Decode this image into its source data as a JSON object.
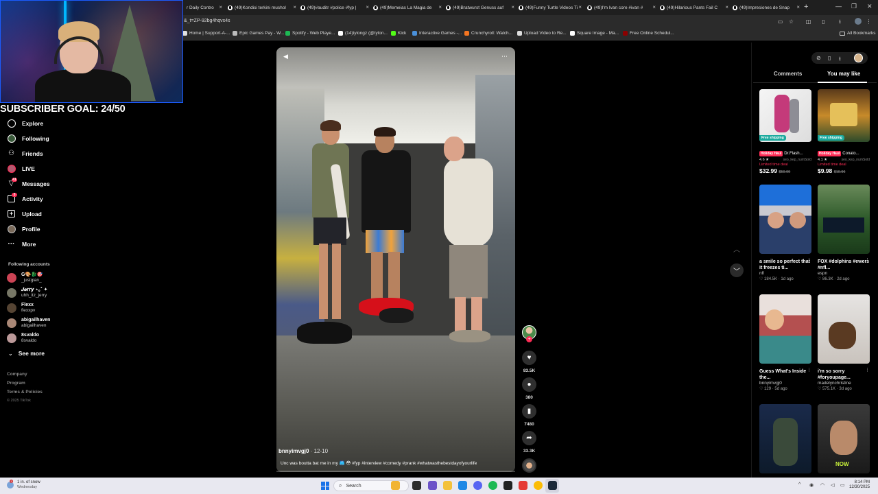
{
  "browser": {
    "tabs": [
      {
        "label": "r Daily Contro",
        "icon": "web-icon"
      },
      {
        "label": "(49)Kondisi terkini mushol",
        "icon": "tiktok-icon"
      },
      {
        "label": "(49)#auditr #police #fyp |",
        "icon": "tiktok-icon"
      },
      {
        "label": "(49)Memeias La Magia de",
        "icon": "tiktok-icon"
      },
      {
        "label": "(49)Bratwurst Genuss auf",
        "icon": "tiktok-icon"
      },
      {
        "label": "(49)Funny Turtle Videos Ti",
        "icon": "tiktok-icon"
      },
      {
        "label": "(49)I'm Ivan core #ivan #",
        "icon": "tiktok-icon"
      },
      {
        "label": "(49)Hilarious Pants Fail C",
        "icon": "tiktok-icon"
      },
      {
        "label": "(49)Impresiones de Snap",
        "icon": "tiktok-icon"
      }
    ],
    "tab_close_glyph": "×",
    "new_tab_glyph": "+",
    "url": "&_t=ZP-92bg4hqvs4s",
    "bookmarks": [
      {
        "label": "Home | Support-A-...",
        "color": "#e0e0e0"
      },
      {
        "label": "Epic Games Pay - W...",
        "color": "#bbbbbb"
      },
      {
        "label": "Spotify - Web Playe...",
        "color": "#1db954"
      },
      {
        "label": "(14)tylongz (@tylon...",
        "color": "#ffffff"
      },
      {
        "label": "Kick",
        "color": "#53fc18"
      },
      {
        "label": "Interactive Games -...",
        "color": "#4a90d9"
      },
      {
        "label": "Crunchyroll: Watch...",
        "color": "#f47521"
      },
      {
        "label": "Upload Video to Re...",
        "color": "#dddddd"
      },
      {
        "label": "Square Image - Ma...",
        "color": "#ffffff"
      },
      {
        "label": "Free Online Schedul...",
        "color": "#8b0000"
      }
    ],
    "all_bookmarks": "All Bookmarks"
  },
  "overlay": {
    "subscriber_goal": "SUBSCRIBER GOAL: 24/50"
  },
  "sidebar": {
    "items": [
      {
        "label": "Explore",
        "icon": "compass-icon"
      },
      {
        "label": "Following",
        "icon": "following-icon"
      },
      {
        "label": "Friends",
        "icon": "friends-icon"
      },
      {
        "label": "LIVE",
        "icon": "live-icon"
      },
      {
        "label": "Messages",
        "icon": "messages-icon",
        "badge": "41"
      },
      {
        "label": "Activity",
        "icon": "activity-icon",
        "badge": "3"
      },
      {
        "label": "Upload",
        "icon": "upload-icon"
      },
      {
        "label": "Profile",
        "icon": "profile-icon"
      },
      {
        "label": "More",
        "icon": "more-icon"
      }
    ],
    "following_title": "Following accounts",
    "following": [
      {
        "name": "G🎨🐉🎯",
        "handle": "_justgian_",
        "color": "#c45"
      },
      {
        "name": "𝑱𝒆𝒓𝒓𝒚 ⋆｡˚ ✦",
        "handle": "uhh_itz_jerry",
        "color": "#776"
      },
      {
        "name": "Flexx",
        "handle": "flexxpv",
        "color": "#543"
      },
      {
        "name": "abigailhaven",
        "handle": "abigailhaven",
        "color": "#a87"
      },
      {
        "name": "8svaldo",
        "handle": "8svaldo",
        "color": "#b99"
      }
    ],
    "see_more": "See more",
    "footer": [
      "Company",
      "Program",
      "Terms & Policies"
    ],
    "copyright": "© 2025 TikTok"
  },
  "video": {
    "author": "bnnyimvgj0",
    "date": "· 12-10",
    "caption": "Unc was boutta bat me in my 🩳 😳 #fyp #interview #comedy #prank #whatwasthebestdayofyourlife",
    "progress": 0.0,
    "likes": "83.5K",
    "comments": "380",
    "saves": "7480",
    "shares": "33.3K"
  },
  "right_panel": {
    "tabs": [
      "Comments",
      "You may like"
    ],
    "active_tab": "You may like",
    "products": [
      {
        "shipping": "Free shipping",
        "holiday": "Holiday Haul",
        "name": "Dr.Flash...",
        "rating": "4.6 ★",
        "sold": "seo_kep_numSold",
        "deal": "Limited time deal",
        "price": "$32.99",
        "old_price": "$59.99"
      },
      {
        "shipping": "Free shipping",
        "holiday": "Holiday Haul",
        "name": "Conato...",
        "rating": "4.1 ★",
        "sold": "seo_kep_numSold",
        "deal": "Limited time deal",
        "price": "$9.98",
        "old_price": "$19.96"
      }
    ],
    "videos": [
      {
        "title": "a smile so perfect that it freezes ti...",
        "author": "nfl",
        "likes": "184.5K",
        "age": "1d ago"
      },
      {
        "title": "FOX #dolphins #ewers #nfl...",
        "author": "espn",
        "likes": "86.3K",
        "age": "2d ago"
      },
      {
        "title": "Guess What's Inside the...",
        "author": "bnnyimvgj0",
        "likes": "129",
        "age": "5d ago"
      },
      {
        "title": "i'm so sorry #foryoupage...",
        "author": "madelynchristine",
        "likes": "575.1K",
        "age": "3d ago"
      }
    ],
    "now_badge": "NOW"
  },
  "taskbar": {
    "weather_text": "1 in. of snow",
    "weather_sub": "Wednesday",
    "weather_badge": "1",
    "search_placeholder": "Search",
    "time": "8:14 PM",
    "date": "12/30/2025"
  }
}
